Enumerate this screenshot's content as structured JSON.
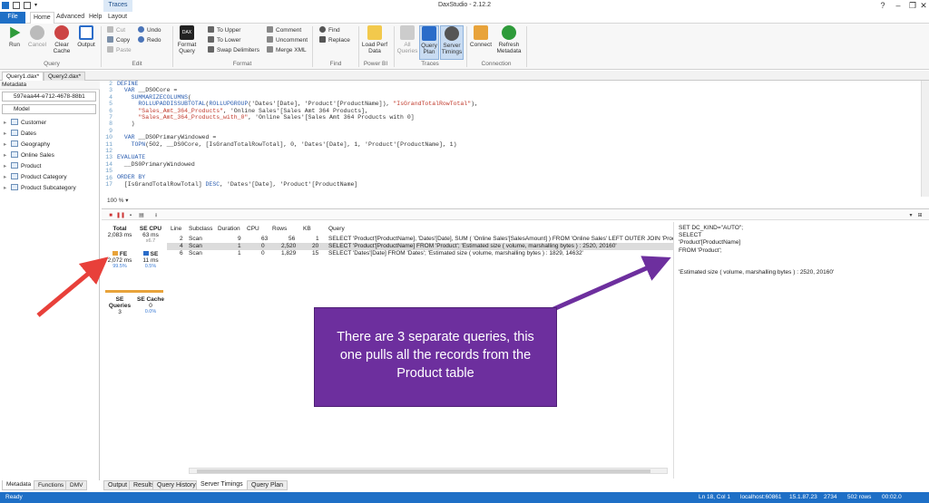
{
  "app": {
    "title": "DaxStudio - 2.12.2"
  },
  "menu_tabs": {
    "file": "File",
    "home": "Home",
    "advanced": "Advanced",
    "help": "Help",
    "traces": "Traces",
    "layout": "Layout"
  },
  "ribbon": {
    "run": "Run",
    "cancel": "Cancel",
    "clear_cache": "Clear Cache",
    "output": "Output",
    "cut": "Cut",
    "copy": "Copy",
    "paste": "Paste",
    "undo": "Undo",
    "redo": "Redo",
    "format_query": "Format Query",
    "to_upper": "To Upper",
    "to_lower": "To Lower",
    "swap_delimiters": "Swap Delimiters",
    "comment": "Comment",
    "uncomment": "Uncomment",
    "merge_xml": "Merge XML",
    "find": "Find",
    "replace": "Replace",
    "load_perf_data": "Load Perf Data",
    "all_queries": "All Queries",
    "query_plan": "Query Plan",
    "server_timings": "Server Timings",
    "connect": "Connect",
    "refresh_metadata": "Refresh Metadata",
    "groups": {
      "query": "Query",
      "edit": "Edit",
      "format": "Format",
      "find": "Find",
      "power_bi": "Power BI",
      "traces": "Traces",
      "connection": "Connection"
    }
  },
  "doc_tabs": [
    "Query1.dax*",
    "Query2.dax*"
  ],
  "metadata": {
    "header": "Metadata",
    "database": "597eaa44-e712-4678-88b1",
    "model": "Model",
    "tables": [
      "Customer",
      "Dates",
      "Geography",
      "Online Sales",
      "Product",
      "Product Category",
      "Product Subcategory"
    ],
    "bottom_tabs": [
      "Metadata",
      "Functions",
      "DMV"
    ]
  },
  "editor": {
    "line_numbers": [
      "2",
      "3",
      "4",
      "5",
      "6",
      "7",
      "8",
      "9",
      "10",
      "11",
      "12",
      "13",
      "14",
      "15",
      "16",
      "17"
    ],
    "lines": [
      "DEFINE",
      "  VAR __DS0Core =",
      "    SUMMARIZECOLUMNS(",
      "      ROLLUPADDISSUBTOTAL(ROLLUPGROUP('Dates'[Date], 'Product'[ProductName]), \"IsGrandTotalRowTotal\"),",
      "      \"Sales_Amt_364_Products\", 'Online Sales'[Sales Amt 364 Products],",
      "      \"Sales_Amt_364_Products_with_0\", 'Online Sales'[Sales Amt 364 Products with 0]",
      "    )",
      "",
      "  VAR __DS0PrimaryWindowed =",
      "    TOPN(502, __DS0Core, [IsGrandTotalRowTotal], 0, 'Dates'[Date], 1, 'Product'[ProductName], 1)",
      "",
      "EVALUATE",
      "  __DS0PrimaryWindowed",
      "",
      "ORDER BY",
      "  [IsGrandTotalRowTotal] DESC, 'Dates'[Date], 'Product'[ProductName]"
    ],
    "zoom": "100 %"
  },
  "server_timings": {
    "total_label": "Total",
    "total_value": "2,083 ms",
    "se_cpu_label": "SE CPU",
    "se_cpu_value": "63 ms",
    "se_cpu_ratio": "x6.7",
    "fe_label": "FE",
    "fe_value": "2,072 ms",
    "fe_pct": "99.5%",
    "se_label": "SE",
    "se_value": "11 ms",
    "se_pct": "0.5%",
    "se_queries_label": "SE Queries",
    "se_queries_value": "3",
    "se_cache_label": "SE Cache",
    "se_cache_value": "0",
    "se_cache_pct": "0.0%",
    "columns": [
      "Line",
      "Subclass",
      "Duration",
      "CPU",
      "Rows",
      "KB",
      "Query"
    ],
    "rows": [
      [
        "2",
        "Scan",
        "9",
        "63",
        "56",
        "1",
        "SELECT 'Product'[ProductName], 'Dates'[Date], SUM ( 'Online Sales'[SalesAmount] ) FROM 'Online Sales' LEFT OUTER JOIN 'Product' O"
      ],
      [
        "4",
        "Scan",
        "1",
        "0",
        "2,520",
        "20",
        "SELECT 'Product'[ProductName] FROM 'Product';  'Estimated size ( volume, marshalling bytes ) : 2520, 20160'"
      ],
      [
        "6",
        "Scan",
        "1",
        "0",
        "1,829",
        "15",
        "SELECT 'Dates'[Date] FROM 'Dates';  'Estimated size ( volume, marshalling bytes ) : 1829, 14632'"
      ]
    ],
    "query_text": [
      "SET DC_KIND=\"AUTO\";",
      "SELECT",
      "'Product'[ProductName]",
      "FROM 'Product';",
      "",
      "",
      "'Estimated size ( volume, marshalling bytes ) : 2520, 20160'"
    ]
  },
  "output_tabs": [
    "Output",
    "Results",
    "Query History",
    "Server Timings",
    "Query Plan"
  ],
  "status_bar": {
    "ready": "Ready",
    "position": "Ln 18, Col 1",
    "server": "localhost:60861",
    "version": "15.1.87.23",
    "spid": "2734",
    "rows": "502 rows",
    "time": "00:02.0"
  },
  "annotation": {
    "text": "There are 3 separate queries, this one pulls all the records from the Product table",
    "color": "#6d2f9e",
    "arrow_red": "#e8403a"
  }
}
